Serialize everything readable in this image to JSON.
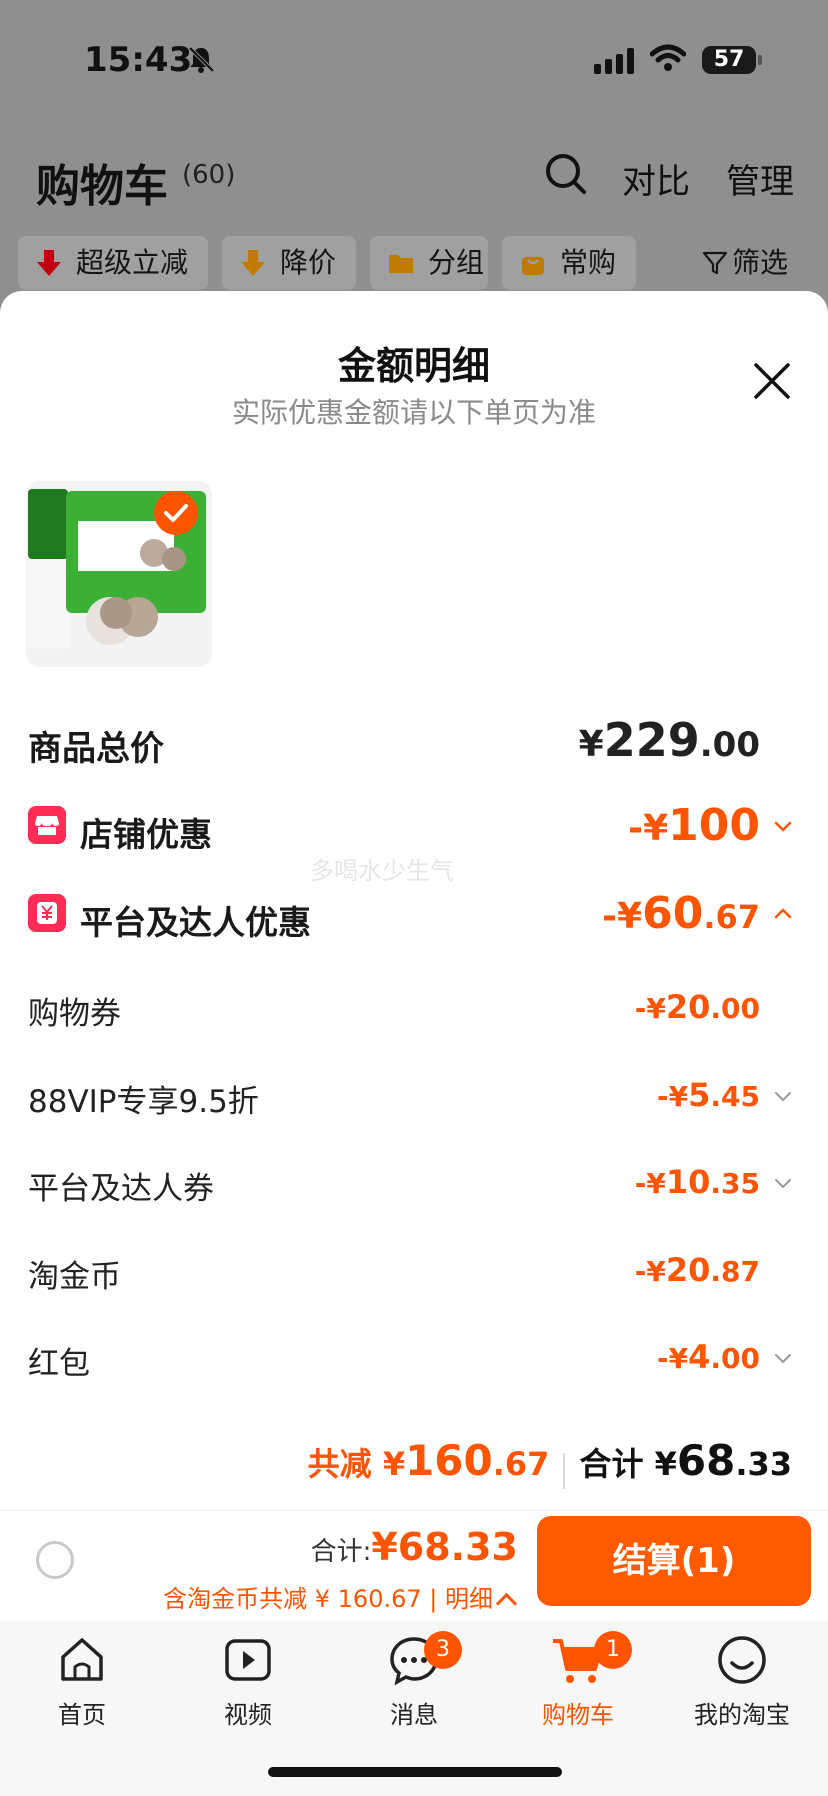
{
  "status": {
    "time": "15:43",
    "battery": "57"
  },
  "cart": {
    "title": "购物车",
    "count": "(60)",
    "compare": "对比",
    "manage": "管理",
    "chips": [
      "超级立减",
      "降价",
      "分组",
      "常购",
      "筛选"
    ]
  },
  "sheet": {
    "title": "金额明细",
    "subtitle": "实际优惠金额请以下单页为准",
    "watermark": "多喝水少生气",
    "product_checked": true,
    "rows": [
      {
        "label": "商品总价",
        "currency": "¥",
        "int": "229",
        "dec": ".00",
        "type": "total"
      },
      {
        "label": "店铺优惠",
        "currency": "-¥",
        "int": "100",
        "dec": "",
        "type": "section",
        "icon": "shop-icon",
        "chevron": "down"
      },
      {
        "label": "平台及达人优惠",
        "currency": "-¥",
        "int": "60",
        "dec": ".67",
        "type": "section",
        "icon": "yen-tag-icon",
        "chevron": "up"
      },
      {
        "label": "购物券",
        "currency": "-¥",
        "int": "20",
        "dec": ".00",
        "type": "item"
      },
      {
        "label": "88VIP专享9.5折",
        "currency": "-¥",
        "int": "5",
        "dec": ".45",
        "type": "item",
        "chevron": "down"
      },
      {
        "label": "平台及达人券",
        "currency": "-¥",
        "int": "10",
        "dec": ".35",
        "type": "item",
        "chevron": "down"
      },
      {
        "label": "淘金币",
        "currency": "-¥",
        "int": "20",
        "dec": ".87",
        "type": "item"
      },
      {
        "label": "红包",
        "currency": "-¥",
        "int": "4",
        "dec": ".00",
        "type": "item",
        "chevron": "down"
      }
    ],
    "summary": {
      "save_label": "共减",
      "save_currency": "¥",
      "save_int": "160",
      "save_dec": ".67",
      "total_label": "合计",
      "total_currency": "¥",
      "total_int": "68",
      "total_dec": ".33"
    }
  },
  "checkout": {
    "total_label": "合计:",
    "total_value": "¥68.33",
    "note": "含淘金币共减 ¥ 160.67 | 明细",
    "button": "结算(1)"
  },
  "tabs": [
    {
      "label": "首页",
      "icon": "home-icon"
    },
    {
      "label": "视频",
      "icon": "video-icon"
    },
    {
      "label": "消息",
      "icon": "message-icon",
      "badge": "3"
    },
    {
      "label": "购物车",
      "icon": "cart-icon",
      "badge": "1",
      "active": true
    },
    {
      "label": "我的淘宝",
      "icon": "profile-icon"
    }
  ],
  "colors": {
    "accent": "#ff5500",
    "icon_red": "#ff2d55",
    "overlay": "#8f8f8f"
  }
}
